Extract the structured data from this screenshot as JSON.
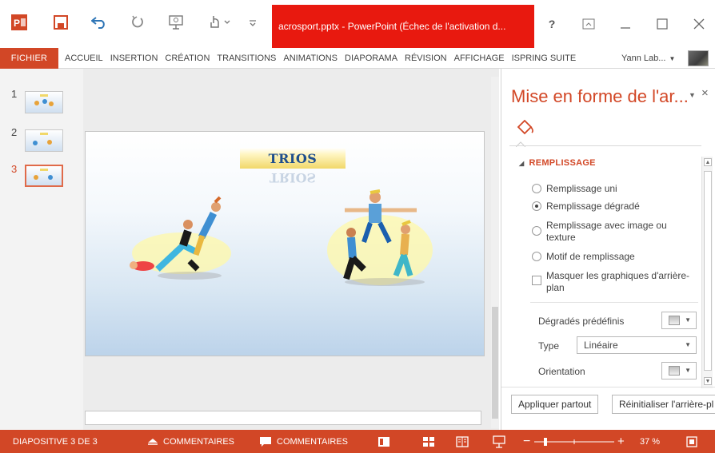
{
  "titlebar": {
    "title": "acrosport.pptx -  PowerPoint (Échec de l'activation d...",
    "help": "?"
  },
  "ribbon": {
    "file_tab": "FICHIER",
    "tabs": [
      "ACCUEIL",
      "INSERTION",
      "CRÉATION",
      "TRANSITIONS",
      "ANIMATIONS",
      "DIAPORAMA",
      "RÉVISION",
      "AFFICHAGE",
      "ISPRING SUITE"
    ],
    "user": "Yann Lab..."
  },
  "thumbnails": [
    {
      "number": "1",
      "selected": false
    },
    {
      "number": "2",
      "selected": false
    },
    {
      "number": "3",
      "selected": true
    }
  ],
  "slide": {
    "title": "TRIOS"
  },
  "panel": {
    "title": "Mise en forme de l'ar...",
    "section": "REMPLISSAGE",
    "fill_options": [
      {
        "label": "Remplissage uni",
        "selected": false
      },
      {
        "label": "Remplissage dégradé",
        "selected": true
      },
      {
        "label": "Remplissage avec image ou",
        "label_line2": "texture",
        "selected": false
      },
      {
        "label": "Motif de remplissage",
        "selected": false
      }
    ],
    "hide_bg": {
      "label": "Masquer les graphiques d'arrière-",
      "label_line2": "plan"
    },
    "preset_label": "Dégradés prédéfinis",
    "type_label": "Type",
    "type_value": "Linéaire",
    "orientation_label": "Orientation",
    "apply_all": "Appliquer partout",
    "reset_bg": "Réinitialiser l'arrière-pl"
  },
  "statusbar": {
    "slide_counter": "DIAPOSITIVE 3 DE 3",
    "notes": "COMMENTAIRES",
    "comments": "COMMENTAIRES",
    "zoom": "37 %"
  },
  "colors": {
    "accent": "#d24726",
    "title_red": "#e8190f"
  }
}
